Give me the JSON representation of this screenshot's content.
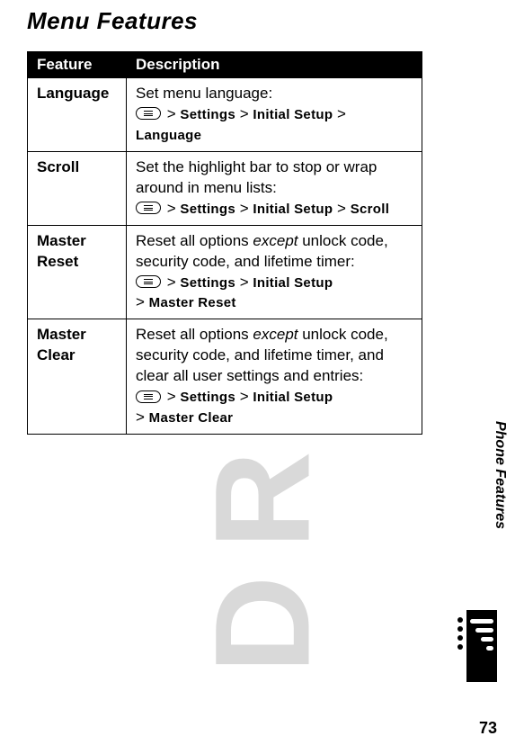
{
  "watermark": "DRAFT",
  "heading": "Menu Features",
  "table": {
    "headers": {
      "feature": "Feature",
      "description": "Description"
    },
    "rows": [
      {
        "feature": "Language",
        "desc": "Set menu language:",
        "path": [
          "Settings",
          "Initial Setup",
          "Language"
        ]
      },
      {
        "feature": "Scroll",
        "desc": "Set the highlight bar to stop or wrap around in menu lists:",
        "path": [
          "Settings",
          "Initial Setup",
          "Scroll"
        ]
      },
      {
        "feature": "Master Reset",
        "desc_pre": "Reset all options ",
        "desc_em": "except",
        "desc_post": " unlock code, security code, and lifetime timer:",
        "path": [
          "Settings",
          "Initial Setup",
          "Master Reset"
        ],
        "wrap_before_last": true
      },
      {
        "feature": "Master Clear",
        "desc_pre": "Reset all options ",
        "desc_em": "except",
        "desc_post": " unlock code, security code, and lifetime timer, and clear all user settings and entries:",
        "path": [
          "Settings",
          "Initial Setup",
          "Master Clear"
        ],
        "wrap_before_last": true
      }
    ]
  },
  "side_label": "Phone Features",
  "page_number": "73",
  "glyphs": {
    "gt": ">"
  }
}
